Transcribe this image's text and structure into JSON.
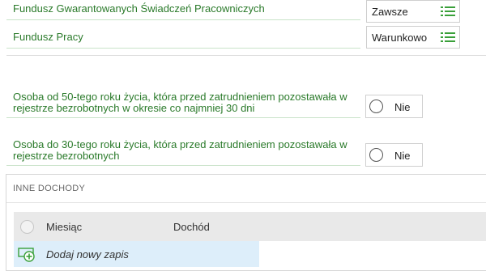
{
  "funds": [
    {
      "label": "Fundusz Gwarantowanych Świadczeń Pracowniczych",
      "value": "Zawsze",
      "options_icon": "list-icon"
    },
    {
      "label": "Fundusz Pracy",
      "value": "Warunkowo",
      "options_icon": "list-icon"
    }
  ],
  "questions": [
    {
      "label": "Osoba od 50-tego roku życia, która przed zatrudnieniem pozostawała w rejestrze bezrobotnych w okresie co najmniej 30 dni",
      "answer": "Nie"
    },
    {
      "label": "Osoba do 30-tego roku życia, która przed zatrudnieniem pozostawała w rejestrze bezrobotnych",
      "answer": "Nie"
    }
  ],
  "other_income": {
    "title": "INNE DOCHODY",
    "columns": [
      "Miesiąc",
      "Dochód"
    ],
    "add_label": "Dodaj nowy zapis"
  },
  "colors": {
    "label_green": "#2a7a2a",
    "icon_green": "#3aa03a",
    "header_bg": "#e9e9e9",
    "add_row_bg": "#ddeefa"
  }
}
